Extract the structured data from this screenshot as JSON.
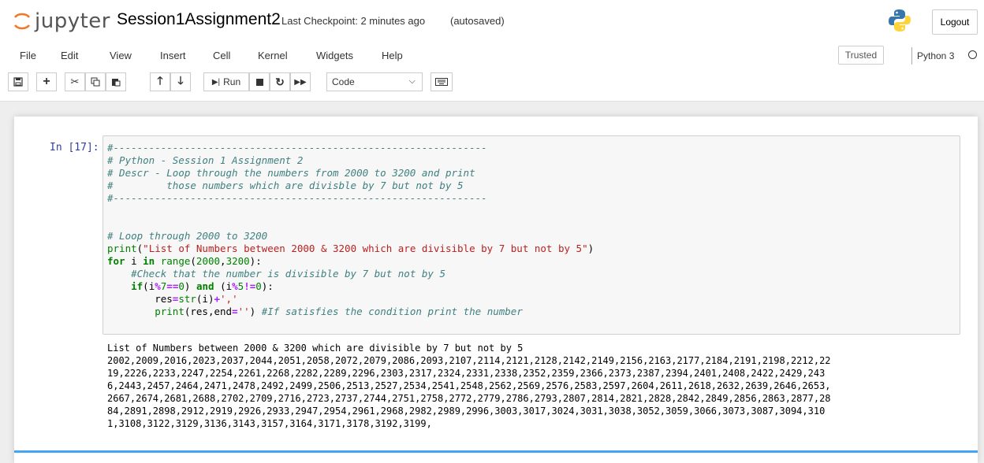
{
  "header": {
    "logo_text": "jupyter",
    "notebook_name": "Session1Assignment2",
    "checkpoint": "Last Checkpoint: 2 minutes ago",
    "autosave": "(autosaved)",
    "logout_label": "Logout"
  },
  "menu": {
    "items": [
      "File",
      "Edit",
      "View",
      "Insert",
      "Cell",
      "Kernel",
      "Widgets",
      "Help"
    ],
    "trusted_label": "Trusted",
    "kernel_name": "Python 3"
  },
  "toolbar": {
    "run_label": "Run",
    "cell_type": "Code"
  },
  "cell": {
    "prompt": "In [17]:",
    "output_header": "List of Numbers between 2000 & 3200 which are divisible by 7 but not by 5",
    "output_lines": [
      "2002,2009,2016,2023,2037,2044,2051,2058,2072,2079,2086,2093,2107,2114,2121,2128,2142,2149,2156,2163,2177,2184,2191,2198,2212,22",
      "19,2226,2233,2247,2254,2261,2268,2282,2289,2296,2303,2317,2324,2331,2338,2352,2359,2366,2373,2387,2394,2401,2408,2422,2429,243",
      "6,2443,2457,2464,2471,2478,2492,2499,2506,2513,2527,2534,2541,2548,2562,2569,2576,2583,2597,2604,2611,2618,2632,2639,2646,2653,",
      "2667,2674,2681,2688,2702,2709,2716,2723,2737,2744,2751,2758,2772,2779,2786,2793,2807,2814,2821,2828,2842,2849,2856,2863,2877,28",
      "84,2891,2898,2912,2919,2926,2933,2947,2954,2961,2968,2982,2989,2996,3003,3017,3024,3031,3038,3052,3059,3066,3073,3087,3094,310",
      "1,3108,3122,3129,3136,3143,3157,3164,3171,3178,3192,3199,"
    ]
  },
  "code": {
    "l1": "#---------------------------------------------------------------",
    "l2": "# Python - Session 1 Assignment 2",
    "l3": "# Descr - Loop through the numbers from 2000 to 3200 and print",
    "l4": "#         those numbers which are divisble by 7 but not by 5",
    "l5": "#---------------------------------------------------------------",
    "l6": "# Loop through 2000 to 3200",
    "l7_fn": "print",
    "l7_str": "\"List of Numbers between 2000 & 3200 which are divisible by 7 but not by 5\"",
    "l8_for": "for",
    "l8_i": " i ",
    "l8_in": "in",
    "l8_range": "range",
    "l8_a": "2000",
    "l8_b": "3200",
    "l9": "#Check that the number is divisible by 7 but not by 5",
    "l10_if": "if",
    "l10_i1": "(i",
    "l10_mod1": "%",
    "l10_n7": "7",
    "l10_eq": "==",
    "l10_n0a": "0",
    "l10_and": "and",
    "l10_i2": "(i",
    "l10_mod2": "%",
    "l10_n5": "5",
    "l10_ne": "!=",
    "l10_n0b": "0",
    "l11_res": "res",
    "l11_eq": "=",
    "l11_str": "str",
    "l11_i": "(i)",
    "l11_plus": "+",
    "l11_comma": "','",
    "l12_print": "print",
    "l12_res": "(res,end",
    "l12_eq": "=",
    "l12_empty": "''",
    "l12_cmt": "#If satisfies the condition print the number"
  },
  "colors": {
    "prompt": "#303f9f",
    "selection": "#42a5f5",
    "comment": "#408080",
    "keyword": "#008000",
    "string": "#ba2121"
  }
}
